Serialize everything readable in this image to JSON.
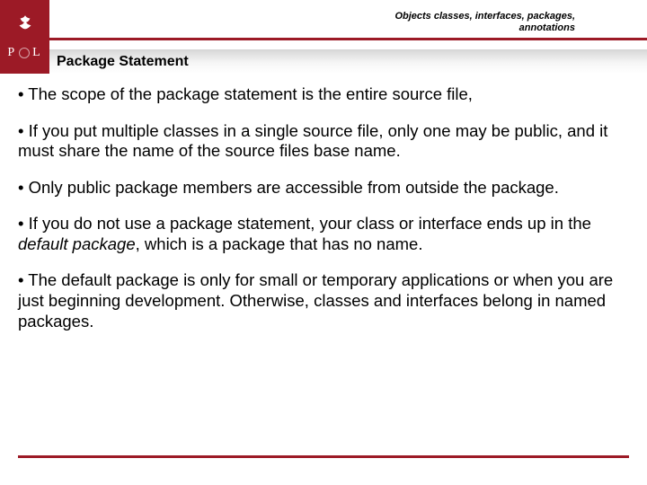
{
  "header": {
    "category_line1": "Objects classes, interfaces, packages,",
    "category_line2": "annotations",
    "logo_left": "P",
    "logo_right": "L",
    "title": "Package Statement"
  },
  "bullets": {
    "b1": "• The scope of the package statement is the entire source file,",
    "b2": "• If you put multiple classes in a single source file, only one may be public, and it must share the name of the source files base name.",
    "b3": "• Only public package members are accessible from outside the package.",
    "b4_pre": "• If you do not use a package statement, your class or interface ends up in the ",
    "b4_ital": "default package",
    "b4_post": ", which is a package that has no name.",
    "b5": "• The default package is only for small or temporary applications or when you are just beginning development. Otherwise, classes and interfaces belong in named packages."
  }
}
